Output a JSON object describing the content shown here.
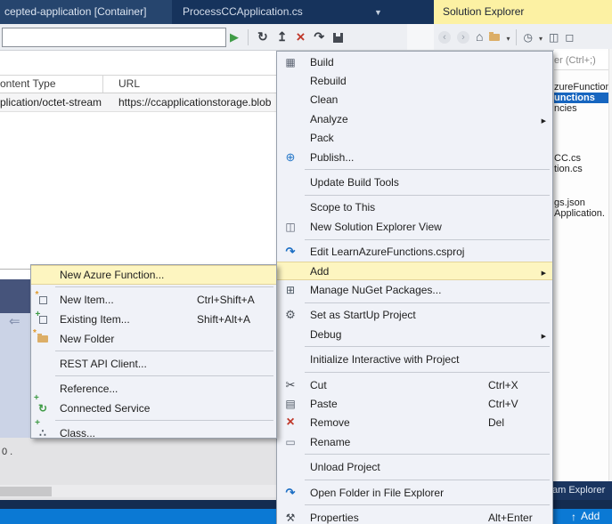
{
  "editor": {
    "tab_container": "cepted-application [Container]",
    "tab_file": "ProcessCCApplication.cs",
    "blob_table": {
      "col_content_type": "ontent Type",
      "col_url": "URL",
      "row_content_type": "plication/octet-stream",
      "row_url": "https://ccapplicationstorage.blob"
    },
    "counter_fragment": "0 ."
  },
  "solution_explorer": {
    "title": "Solution Explorer",
    "search_fragment": "er (Ctrl+;)",
    "tree": [
      "zureFunction",
      "unctions",
      "ncies",
      "CC.cs",
      "tion.cs",
      "gs.json",
      "Application."
    ],
    "selected_item": "unctions",
    "bottom_tab_fragment": "am Explorer"
  },
  "context_menu": {
    "items": [
      {
        "label": "Build",
        "icon": "build-icon"
      },
      {
        "label": "Rebuild"
      },
      {
        "label": "Clean"
      },
      {
        "label": "Analyze",
        "submenu": true
      },
      {
        "label": "Pack"
      },
      {
        "label": "Publish...",
        "icon": "publish-icon"
      },
      {
        "separator": true
      },
      {
        "label": "Update Build Tools"
      },
      {
        "separator": true
      },
      {
        "label": "Scope to This"
      },
      {
        "label": "New Solution Explorer View",
        "icon": "new-solution-explorer-view-icon"
      },
      {
        "separator": true
      },
      {
        "label": "Edit LearnAzureFunctions.csproj",
        "icon": "edit-file-icon"
      },
      {
        "label": "Add",
        "submenu": true,
        "highlighted": true
      },
      {
        "label": "Manage NuGet Packages...",
        "icon": "nuget-icon"
      },
      {
        "separator": true
      },
      {
        "label": "Set as StartUp Project",
        "icon": "gear-icon"
      },
      {
        "label": "Debug",
        "submenu": true
      },
      {
        "separator": true
      },
      {
        "label": "Initialize Interactive with Project"
      },
      {
        "separator": true
      },
      {
        "label": "Cut",
        "shortcut": "Ctrl+X",
        "icon": "scissors-icon"
      },
      {
        "label": "Paste",
        "shortcut": "Ctrl+V",
        "icon": "clipboard-icon"
      },
      {
        "label": "Remove",
        "shortcut": "Del",
        "icon": "red-x-icon"
      },
      {
        "label": "Rename",
        "icon": "rename-icon"
      },
      {
        "separator": true
      },
      {
        "label": "Unload Project"
      },
      {
        "separator": true
      },
      {
        "label": "Open Folder in File Explorer",
        "icon": "open-folder-icon"
      },
      {
        "separator": true
      },
      {
        "label": "Properties",
        "shortcut": "Alt+Enter",
        "icon": "wrench-icon"
      }
    ]
  },
  "add_submenu": {
    "items": [
      {
        "label": "New Azure Function...",
        "highlighted": true
      },
      {
        "separator": true
      },
      {
        "label": "New Item...",
        "shortcut": "Ctrl+Shift+A",
        "icon": "new-item-icon"
      },
      {
        "label": "Existing Item...",
        "shortcut": "Shift+Alt+A",
        "icon": "existing-item-icon"
      },
      {
        "label": "New Folder",
        "icon": "new-folder-icon"
      },
      {
        "separator": true
      },
      {
        "label": "REST API Client..."
      },
      {
        "separator": true
      },
      {
        "label": "Reference..."
      },
      {
        "label": "Connected Service",
        "icon": "connected-service-icon"
      },
      {
        "separator": true
      },
      {
        "label": "Class...",
        "icon": "class-icon"
      }
    ]
  },
  "status_bar": {
    "add_fragment": "Add"
  },
  "colors": {
    "selection_blue": "#1766c0",
    "menu_highlight": "#fdf5c0",
    "status_bar_blue": "#0b79d4",
    "title_highlight_yellow": "#fcf1a3",
    "band_navy": "#16335c"
  }
}
